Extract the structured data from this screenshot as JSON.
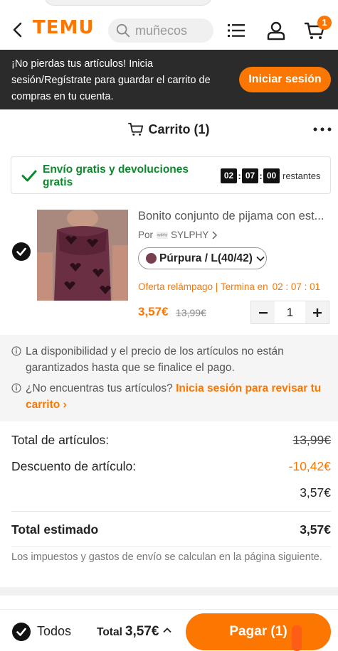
{
  "header": {
    "logo": "TEMU",
    "search_placeholder": "muñecos",
    "cart_count": "1"
  },
  "banner": {
    "message": "¡No pierdas tus artículos! Inicia sesión/Regístrate para guardar el carrito de compras en tu cuenta.",
    "login_label": "Iniciar sesión"
  },
  "cart": {
    "title": "Carrito (1)"
  },
  "shipping": {
    "text": "Envío gratis y devoluciones gratis",
    "timer_h": "02",
    "timer_m": "07",
    "timer_s": "00",
    "timer_label": "restantes"
  },
  "item": {
    "title": "Bonito conjunto de pijama con est...",
    "by_label": "Por",
    "store_mini": "sylphy",
    "store": "SYLPHY",
    "variant": "Púrpura / L(40/42)",
    "flash_label": "Oferta relámpago | Termina en",
    "flash_time": "02 : 07 : 01",
    "price": "3,57€",
    "old_price": "13,99€",
    "quantity": "1"
  },
  "info": {
    "availability": "La disponibilidad y el precio de los artículos no están garantizados hasta que se finalice el pago.",
    "missing_prefix": "¿No encuentras tus artículos?",
    "missing_link": "Inicia sesión para revisar tu carrito"
  },
  "summary": {
    "items_label": "Total de artículos:",
    "items_value": "13,99€",
    "discount_label": "Descuento de artículo:",
    "discount_value": "-10,42€",
    "subtotal_value": "3,57€",
    "estimated_label": "Total estimado",
    "estimated_value": "3,57€",
    "tax_note": "Los impuestos y gastos de envío se calculan en la página siguiente."
  },
  "footer": {
    "all_label": "Todos",
    "total_label": "Total",
    "total_value": "3,57€",
    "pay_label": "Pagar (1)"
  },
  "colors": {
    "accent": "#fb7701",
    "success": "#0a8a2b",
    "banner_bg": "#2b2b2b"
  }
}
